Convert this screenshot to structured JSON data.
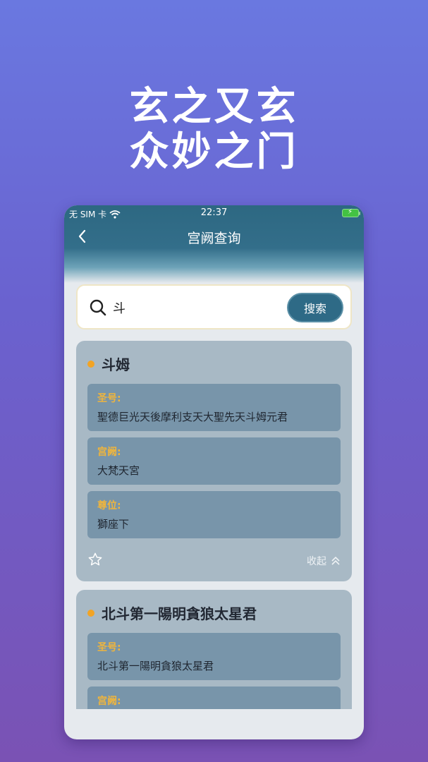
{
  "promo": {
    "line1": "玄之又玄",
    "line2": "众妙之门"
  },
  "status_bar": {
    "carrier": "无 SIM 卡",
    "time": "22:37"
  },
  "navbar": {
    "title": "宫阙查询"
  },
  "search": {
    "value": "斗",
    "button_label": "搜索"
  },
  "results": [
    {
      "name": "斗姆",
      "fields": [
        {
          "label": "圣号:",
          "value": "聖德巨光天後摩利支天大聖先天斗姆元君"
        },
        {
          "label": "宫阙:",
          "value": "大梵天宮"
        },
        {
          "label": "尊位:",
          "value": "獅座下"
        }
      ],
      "collapse_label": "收起"
    },
    {
      "name": "北斗第一陽明貪狼太星君",
      "fields": [
        {
          "label": "圣号:",
          "value": "北斗第一陽明貪狼太星君"
        },
        {
          "label": "宫阙:",
          "value": ""
        }
      ]
    }
  ],
  "colors": {
    "header": "#2d6882",
    "card": "#a8b9c5",
    "field": "#7895aa",
    "label": "#efb53d",
    "dot": "#f2a425"
  }
}
